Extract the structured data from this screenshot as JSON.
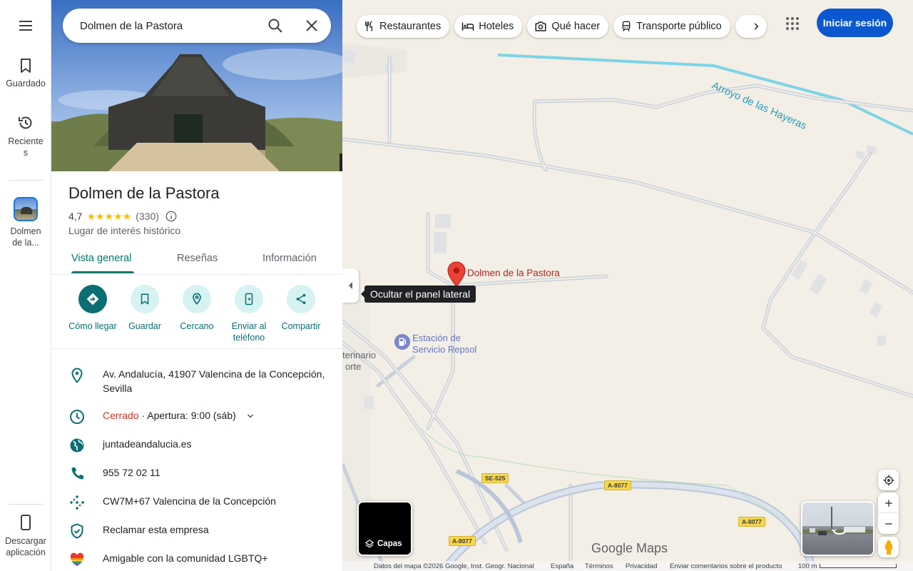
{
  "rail": {
    "saved_label": "Guardado",
    "recent_label_1": "Reciente",
    "recent_label_2": "s",
    "recent_place_label_1": "Dolmen",
    "recent_place_label_2": "de la...",
    "download_label_1": "Descargar",
    "download_label_2": "aplicación"
  },
  "search": {
    "value": "Dolmen de la Pastora"
  },
  "place": {
    "title": "Dolmen de la Pastora",
    "rating": "4,7",
    "stars": "★★★★★",
    "review_count": "(330)",
    "category": "Lugar de interés histórico"
  },
  "tabs": [
    {
      "label": "Vista general"
    },
    {
      "label": "Reseñas"
    },
    {
      "label": "Información"
    }
  ],
  "actions": [
    {
      "label": "Cómo llegar"
    },
    {
      "label": "Guardar"
    },
    {
      "label": "Cercano"
    },
    {
      "label": "Enviar al teléfono"
    },
    {
      "label": "Compartir"
    }
  ],
  "info": {
    "address": "Av. Andalucía, 41907 Valencina de la Concepción, Sevilla",
    "status": "Cerrado",
    "hours": " · Apertura: 9:00 (sáb)",
    "website": "juntadeandalucia.es",
    "phone": "955 72 02 11",
    "plus_code": "CW7M+67 Valencina de la Concepción",
    "claim": "Reclamar esta empresa",
    "lgbtq": "Amigable con la comunidad LGBTQ+"
  },
  "chips": [
    {
      "label": "Restaurantes",
      "icon": "fork-knife-icon"
    },
    {
      "label": "Hoteles",
      "icon": "bed-icon"
    },
    {
      "label": "Qué hacer",
      "icon": "camera-icon"
    },
    {
      "label": "Transporte público",
      "icon": "train-icon"
    }
  ],
  "header": {
    "signin_label": "Iniciar sesión"
  },
  "map": {
    "tooltip": "Ocultar el panel lateral",
    "pin_label": "Dolmen de la Pastora",
    "poi_label_1": "Estación de",
    "poi_label_2": "Servicio Repsol",
    "cut_label_1": "terinario",
    "cut_label_2": "orte",
    "stream_label": "Arroyo de las Hayeras",
    "roads": [
      "SE-525",
      "A-8077",
      "A-8077",
      "A-8077"
    ],
    "layers_label": "Capas",
    "logo": "Google Maps",
    "pin_color": "#ea4335",
    "water_color": "#7dd3e8"
  },
  "footer": {
    "data": "Datos del mapa ©2026 Google, Inst. Geogr. Nacional",
    "country": "España",
    "terms": "Términos",
    "privacy": "Privacidad",
    "feedback": "Enviar comentarios sobre el producto",
    "scale": "100 m"
  }
}
